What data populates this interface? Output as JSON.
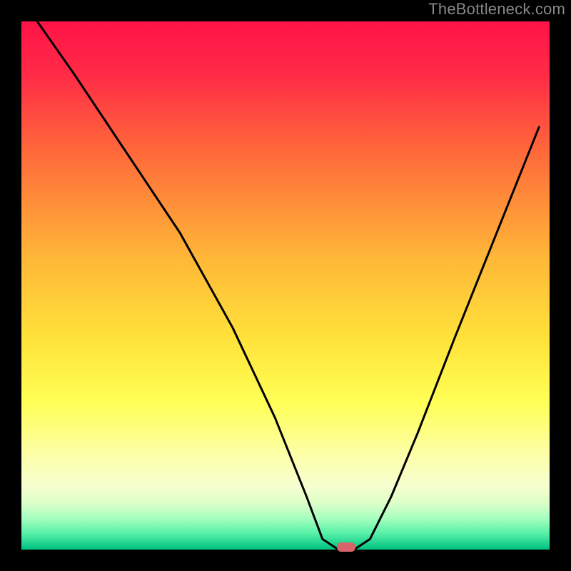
{
  "watermark": "TheBottleneck.com",
  "colors": {
    "background": "#000000",
    "curve": "#000000",
    "marker_fill": "#d9636a",
    "watermark_text": "#808080",
    "gradient_top": "#ff1347",
    "gradient_mid1": "#ff6a3a",
    "gradient_mid2": "#ffd23a",
    "gradient_mid3": "#ffff55",
    "gradient_light": "#fbffc0",
    "gradient_green1": "#b8ffb0",
    "gradient_green2": "#6affb0",
    "gradient_green3": "#00e090",
    "gradient_green4": "#00c080"
  },
  "chart_data": {
    "type": "line",
    "title": "",
    "xlabel": "",
    "ylabel": "",
    "xlim": [
      0,
      100
    ],
    "ylim": [
      0,
      100
    ],
    "series": [
      {
        "name": "bottleneck-curve",
        "x": [
          3,
          10,
          20,
          30,
          40,
          48,
          54,
          57,
          60,
          63,
          66,
          70,
          75,
          82,
          90,
          98
        ],
        "y": [
          100,
          90,
          75,
          60,
          42,
          25,
          10,
          2,
          0,
          0,
          2,
          10,
          22,
          40,
          60,
          80
        ]
      }
    ],
    "optimal_marker": {
      "x": 61.5,
      "y": 0
    }
  }
}
